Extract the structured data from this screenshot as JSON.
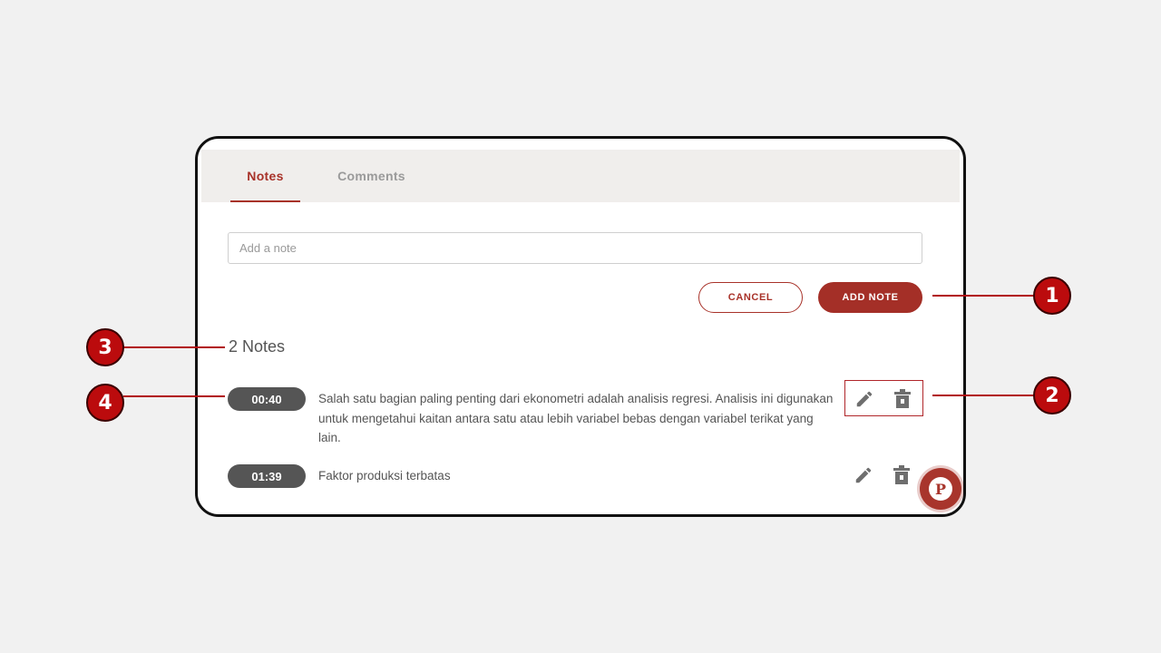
{
  "tabs": [
    {
      "label": "Notes",
      "active": true
    },
    {
      "label": "Comments",
      "active": false
    }
  ],
  "note_input": {
    "placeholder": "Add a note",
    "value": ""
  },
  "buttons": {
    "cancel_label": "CANCEL",
    "add_note_label": "ADD NOTE"
  },
  "notes_count_label": "2 Notes",
  "notes": [
    {
      "timestamp": "00:40",
      "text": "Salah satu bagian paling penting dari ekonometri adalah analisis regresi. Analisis ini digunakan untuk mengetahui kaitan antara satu atau lebih variabel bebas dengan variabel terikat yang lain.",
      "actions": [
        "pencil-icon",
        "trash-icon"
      ]
    },
    {
      "timestamp": "01:39",
      "text": "Faktor produksi terbatas",
      "actions": [
        "pencil-icon",
        "trash-icon"
      ]
    }
  ],
  "fab": {
    "letter": "P"
  },
  "callouts": [
    "1",
    "2",
    "3",
    "4"
  ],
  "colors": {
    "accent": "#a83229",
    "callout": "#bb0b0d",
    "timestamp_bg": "#555555",
    "tab_bar_bg": "#f0eeec",
    "page_bg": "#f1f1f1"
  }
}
